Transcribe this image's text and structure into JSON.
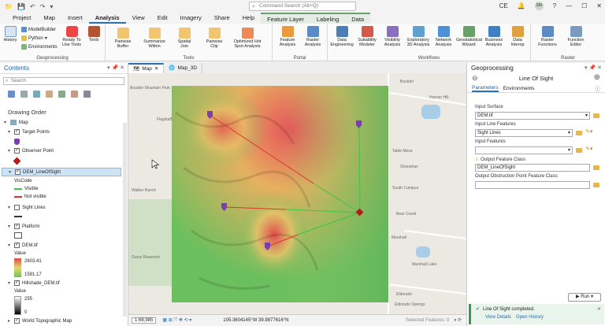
{
  "quick_access": [
    "📁",
    "💾",
    "↶",
    "↷",
    "▾"
  ],
  "command_search": {
    "placeholder": "Command Search (Alt+Q)"
  },
  "user": {
    "initials": "SM",
    "region": "CE"
  },
  "ribbon_tabs": [
    "Project",
    "Map",
    "Insert",
    "Analysis",
    "View",
    "Edit",
    "Imagery",
    "Share",
    "Help"
  ],
  "active_tab": "Analysis",
  "contextual_tabs": [
    "Feature Layer",
    "Labeling",
    "Data"
  ],
  "ribbon": {
    "geoprocessing": {
      "label": "Geoprocessing",
      "history": "History",
      "modelbuilder": "ModelBuilder",
      "python": "Python",
      "environments": "Environments",
      "ready": "Ready To Use Tools",
      "tools": "Tools"
    },
    "tools": {
      "label": "Tools",
      "items": [
        "Pairwise Buffer",
        "Summarize Within",
        "Spatial Join",
        "Pairwise Clip",
        "Optimized Hot Spot Analysis"
      ]
    },
    "portal": {
      "label": "Portal",
      "items": [
        "Feature Analysis",
        "Raster Analysis"
      ]
    },
    "workflows": {
      "label": "Workflows",
      "items": [
        "Data Engineering",
        "Suitability Modeler",
        "Visibility Analysis",
        "Exploratory 3D Analysis",
        "Network Analysis",
        "Geostatistical Wizard",
        "Business Analysis",
        "Data Interop"
      ]
    },
    "raster": {
      "label": "Raster",
      "items": [
        "Raster Functions",
        "Function Editor"
      ]
    }
  },
  "contents": {
    "title": "Contents",
    "search_placeholder": "Search",
    "drawing_order": "Drawing Order",
    "layers": {
      "map": "Map",
      "target_points": "Target Points",
      "observer_point": "Observer Point",
      "dem_los": "DEM_LineOfSight",
      "viscode": "VisCode",
      "visible": "Visible",
      "not_visible": "Not visible",
      "sight_lines": "Sight Lines",
      "platform": "Platform",
      "dem": "DEM.tif",
      "value": "Value",
      "dem_max": "2603.41",
      "dem_min": "1591.17",
      "hillshade": "Hillshade_DEM.tif",
      "hs_value": "Value",
      "hs_max": "255",
      "hs_min": "0",
      "topo": "World Topographic Map"
    }
  },
  "map_tabs": [
    "Map",
    "Map_3D"
  ],
  "map_labels": [
    "Boulder Mountain Park",
    "Marshall",
    "Marshall Lake",
    "Flagstaff",
    "Eldorado",
    "South Campus",
    "Boulder",
    "Gross Reservoir",
    "Walker Ranch",
    "Bear Creek",
    "Hoover Hill",
    "Eldorado Springs",
    "Shanahan",
    "Table Mesa"
  ],
  "status": {
    "scale": "1:68,985",
    "coords": "105.3604145°W 39.9877616°N",
    "selected": "Selected Features: 0"
  },
  "geoprocessing": {
    "title": "Geoprocessing",
    "tool": "Line Of Sight",
    "tabs": [
      "Parameters",
      "Environments"
    ],
    "input_surface_label": "Input Surface",
    "input_surface": "DEM.tif",
    "input_line_label": "Input Line Features",
    "input_line": "Sight Lines",
    "input_features_label": "Input Features",
    "input_features": "",
    "output_label": "Output Feature Class",
    "output": "DEM_LineOfSight",
    "obstruction_label": "Output Obstruction Point Feature Class",
    "obstruction": "",
    "run": "Run",
    "toast": "Line Of Sight completed.",
    "view_details": "View Details",
    "open_history": "Open History"
  },
  "colors": {
    "accent": "#2a6fb0",
    "visible": "#3ec43e",
    "not_visible": "#d9342b",
    "observer": "#b71c1c",
    "target": "#7a3fa8"
  }
}
